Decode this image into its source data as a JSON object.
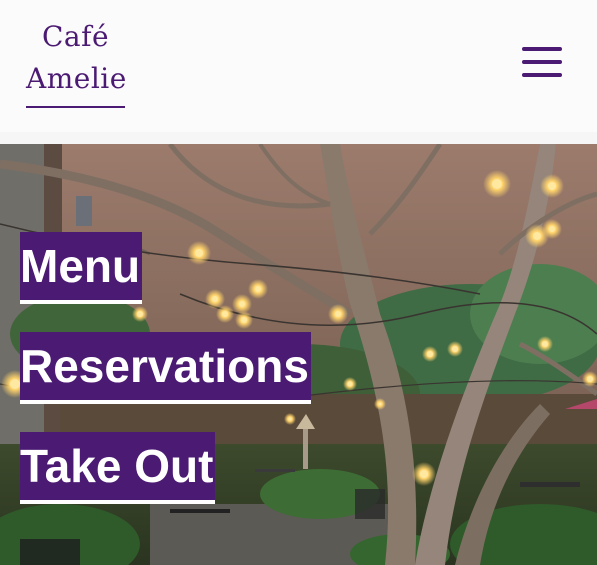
{
  "header": {
    "logo_line1": "Café",
    "logo_line2": "Amelie"
  },
  "nav": {
    "menu_icon": "hamburger-menu-icon"
  },
  "hero": {
    "image": "courtyard-garden-with-string-lights",
    "links": [
      {
        "label": "Menu"
      },
      {
        "label": "Reservations"
      },
      {
        "label": "Take Out"
      }
    ]
  },
  "colors": {
    "brand_purple": "#4b1a72",
    "button_text": "#ffffff",
    "header_bg": "#fbfbfb"
  }
}
